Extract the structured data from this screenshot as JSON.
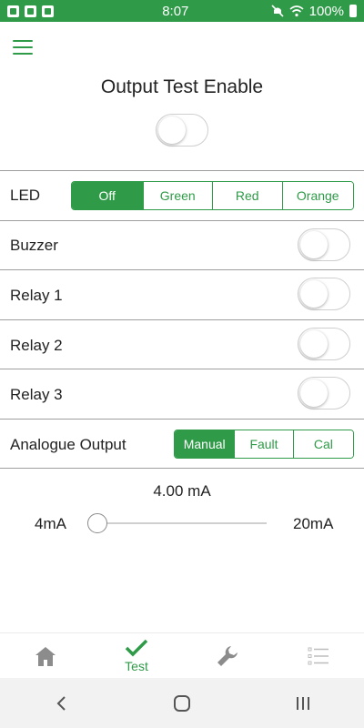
{
  "status_bar": {
    "time": "8:07",
    "battery": "100%"
  },
  "header": {
    "title": "Output Test Enable"
  },
  "led": {
    "label": "LED",
    "options": [
      "Off",
      "Green",
      "Red",
      "Orange"
    ],
    "selected": "Off"
  },
  "rows": [
    {
      "label": "Buzzer"
    },
    {
      "label": "Relay 1"
    },
    {
      "label": "Relay 2"
    },
    {
      "label": "Relay 3"
    }
  ],
  "analogue": {
    "label": "Analogue Output",
    "options": [
      "Manual",
      "Fault",
      "Cal"
    ],
    "selected": "Manual"
  },
  "slider": {
    "value_text": "4.00 mA",
    "min_label": "4mA",
    "max_label": "20mA",
    "value": 0.0
  },
  "bottom_nav": {
    "items": [
      {
        "icon": "home-icon",
        "label": ""
      },
      {
        "icon": "check-icon",
        "label": "Test"
      },
      {
        "icon": "wrench-icon",
        "label": ""
      },
      {
        "icon": "list-icon",
        "label": ""
      }
    ]
  },
  "colors": {
    "accent": "#2f9a48",
    "inactive_icon": "#8c8c8c"
  }
}
